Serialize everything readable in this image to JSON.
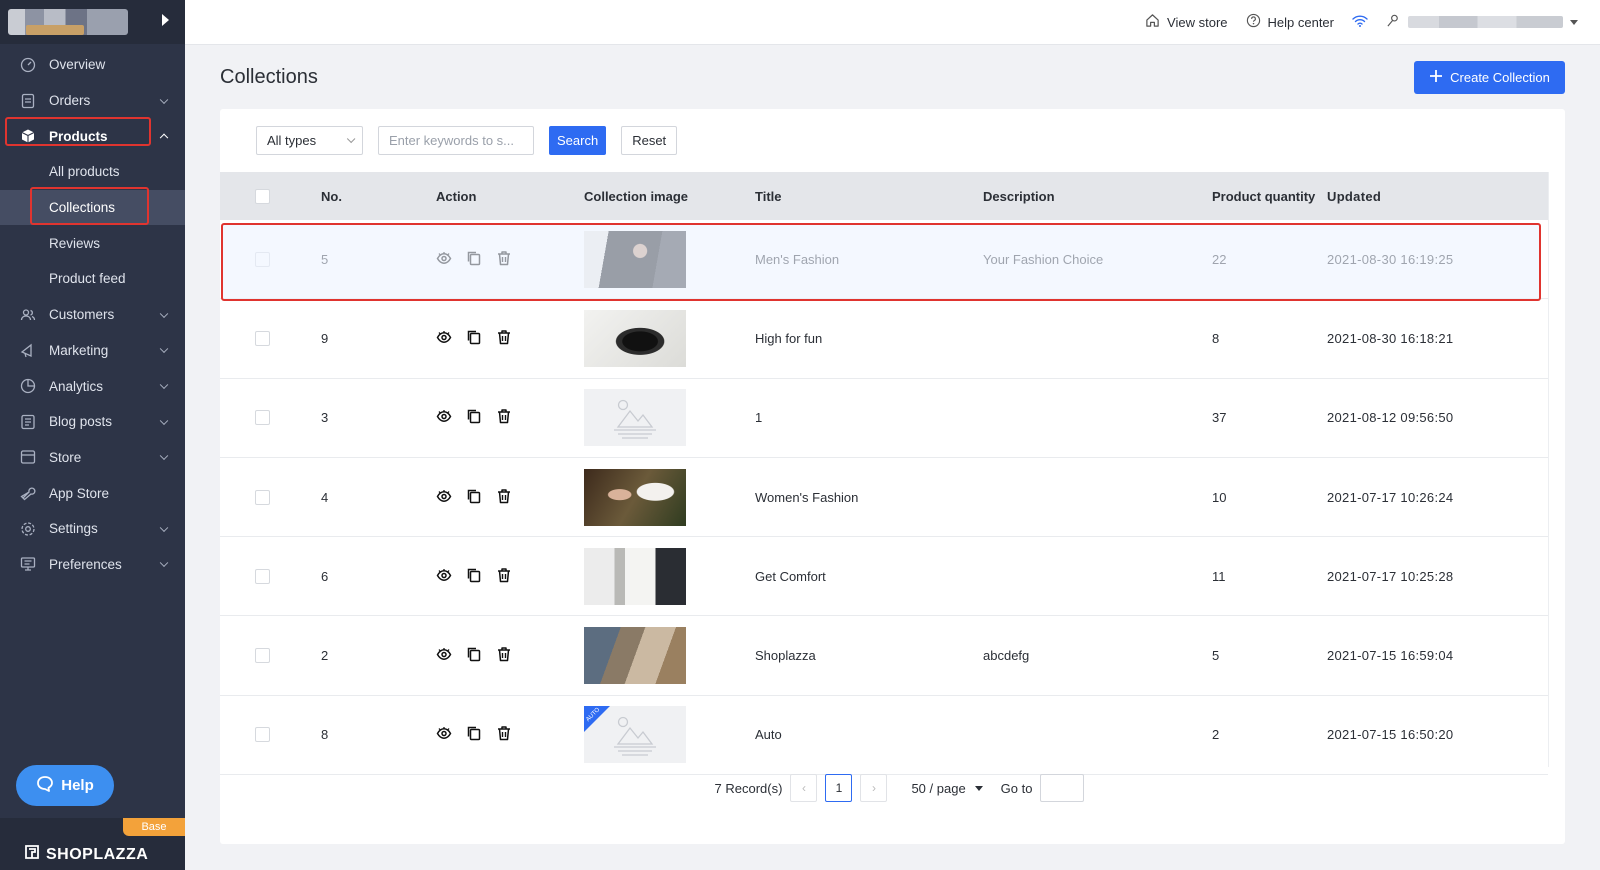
{
  "sidebar": {
    "nav": [
      {
        "label": "Overview",
        "icon": "overview-icon",
        "expandable": false
      },
      {
        "label": "Orders",
        "icon": "orders-icon",
        "expandable": true
      },
      {
        "label": "Products",
        "icon": "products-icon",
        "expandable": true,
        "expanded": true
      },
      {
        "label": "All products",
        "sub": true
      },
      {
        "label": "Collections",
        "sub": true,
        "current": true
      },
      {
        "label": "Reviews",
        "sub": true
      },
      {
        "label": "Product feed",
        "sub": true
      },
      {
        "label": "Customers",
        "icon": "customers-icon",
        "expandable": true
      },
      {
        "label": "Marketing",
        "icon": "marketing-icon",
        "expandable": true
      },
      {
        "label": "Analytics",
        "icon": "analytics-icon",
        "expandable": true
      },
      {
        "label": "Blog posts",
        "icon": "blog-icon",
        "expandable": true
      },
      {
        "label": "Store",
        "icon": "store-icon",
        "expandable": true
      },
      {
        "label": "App Store",
        "icon": "app-store-icon",
        "expandable": false
      },
      {
        "label": "Settings",
        "icon": "settings-icon",
        "expandable": true
      },
      {
        "label": "Preferences",
        "icon": "preferences-icon",
        "expandable": true
      }
    ],
    "help_label": "Help",
    "plan_badge": "Base",
    "brand": "SHOPLAZZA"
  },
  "topbar": {
    "view_store": "View store",
    "help_center": "Help center"
  },
  "main": {
    "title": "Collections",
    "create_label": "Create Collection",
    "filters": {
      "type_value": "All types",
      "search_placeholder": "Enter keywords to s...",
      "search_label": "Search",
      "reset_label": "Reset"
    },
    "table": {
      "headers": {
        "no": "No.",
        "action": "Action",
        "image": "Collection image",
        "title": "Title",
        "description": "Description",
        "quantity": "Product quantity",
        "updated": "Updated"
      },
      "rows": [
        {
          "no": "5",
          "title": "Men's Fashion",
          "description": "Your Fashion Choice",
          "quantity": "22",
          "updated": "2021-08-30 16:19:25",
          "image": "photo-mens"
        },
        {
          "no": "9",
          "title": "High for fun",
          "description": "",
          "quantity": "8",
          "updated": "2021-08-30 16:18:21",
          "image": "photo-headphones"
        },
        {
          "no": "3",
          "title": "1",
          "description": "",
          "quantity": "37",
          "updated": "2021-08-12 09:56:50",
          "image": "placeholder"
        },
        {
          "no": "4",
          "title": "Women's Fashion",
          "description": "",
          "quantity": "10",
          "updated": "2021-07-17 10:26:24",
          "image": "photo-womens"
        },
        {
          "no": "6",
          "title": "Get Comfort",
          "description": "",
          "quantity": "11",
          "updated": "2021-07-17 10:25:28",
          "image": "photo-interior"
        },
        {
          "no": "2",
          "title": "Shoplazza",
          "description": "abcdefg",
          "quantity": "5",
          "updated": "2021-07-15 16:59:04",
          "image": "photo-bags"
        },
        {
          "no": "8",
          "title": "Auto",
          "description": "",
          "quantity": "2",
          "updated": "2021-07-15 16:50:20",
          "image": "placeholder-auto",
          "badge": "AUTO"
        }
      ]
    },
    "pagination": {
      "records": "7 Record(s)",
      "current_page": "1",
      "per_page": "50 / page",
      "goto_label": "Go to"
    }
  },
  "colors": {
    "sidebar_bg": "#2d3447",
    "accent": "#2e6bf2",
    "highlight": "#e0342f",
    "help_button": "#3d8ff0",
    "base_badge": "#f3a23a"
  }
}
